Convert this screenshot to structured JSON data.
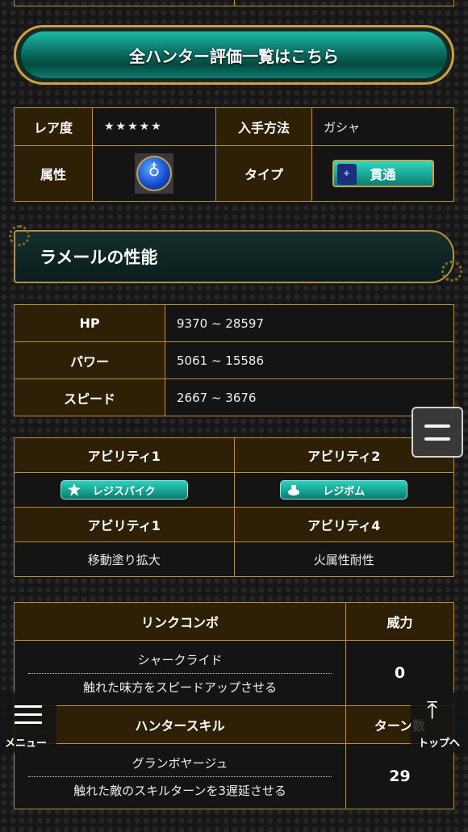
{
  "banner": {
    "label": "全ハンター評価一覧はこちら"
  },
  "info": {
    "rarity_label": "レア度",
    "rarity_value": "★★★★★",
    "obtain_label": "入手方法",
    "obtain_value": "ガシャ",
    "attribute_label": "属性",
    "attribute_icon": "water-attribute-icon",
    "type_label": "タイプ",
    "type_value": "貫通"
  },
  "section": {
    "title": "ラメールの性能"
  },
  "stats": [
    {
      "label": "HP",
      "value": "9370 ~ 28597"
    },
    {
      "label": "パワー",
      "value": "5061 ~ 15586"
    },
    {
      "label": "スピード",
      "value": "2667 ~ 3676"
    }
  ],
  "abilities": {
    "h1": "アビリティ1",
    "h2": "アビリティ2",
    "a1": "レジスパイク",
    "a2": "レジボム",
    "h3": "アビリティ1",
    "h4": "アビリティ4",
    "a3": "移動塗り拡大",
    "a4": "火属性耐性"
  },
  "link_combo": {
    "header": "リンクコンボ",
    "power_header": "威力",
    "name": "シャークライド",
    "description": "触れた味方をスピードアップさせる",
    "power": "0"
  },
  "hunter_skill": {
    "header": "ハンタースキル",
    "turn_header": "ターン数",
    "name": "グランボヤージュ",
    "description": "触れた敵のスキルターンを3遅延させる",
    "turns": "29"
  },
  "floating": {
    "menu_label": "メニュー",
    "top_label": "トップへ"
  }
}
